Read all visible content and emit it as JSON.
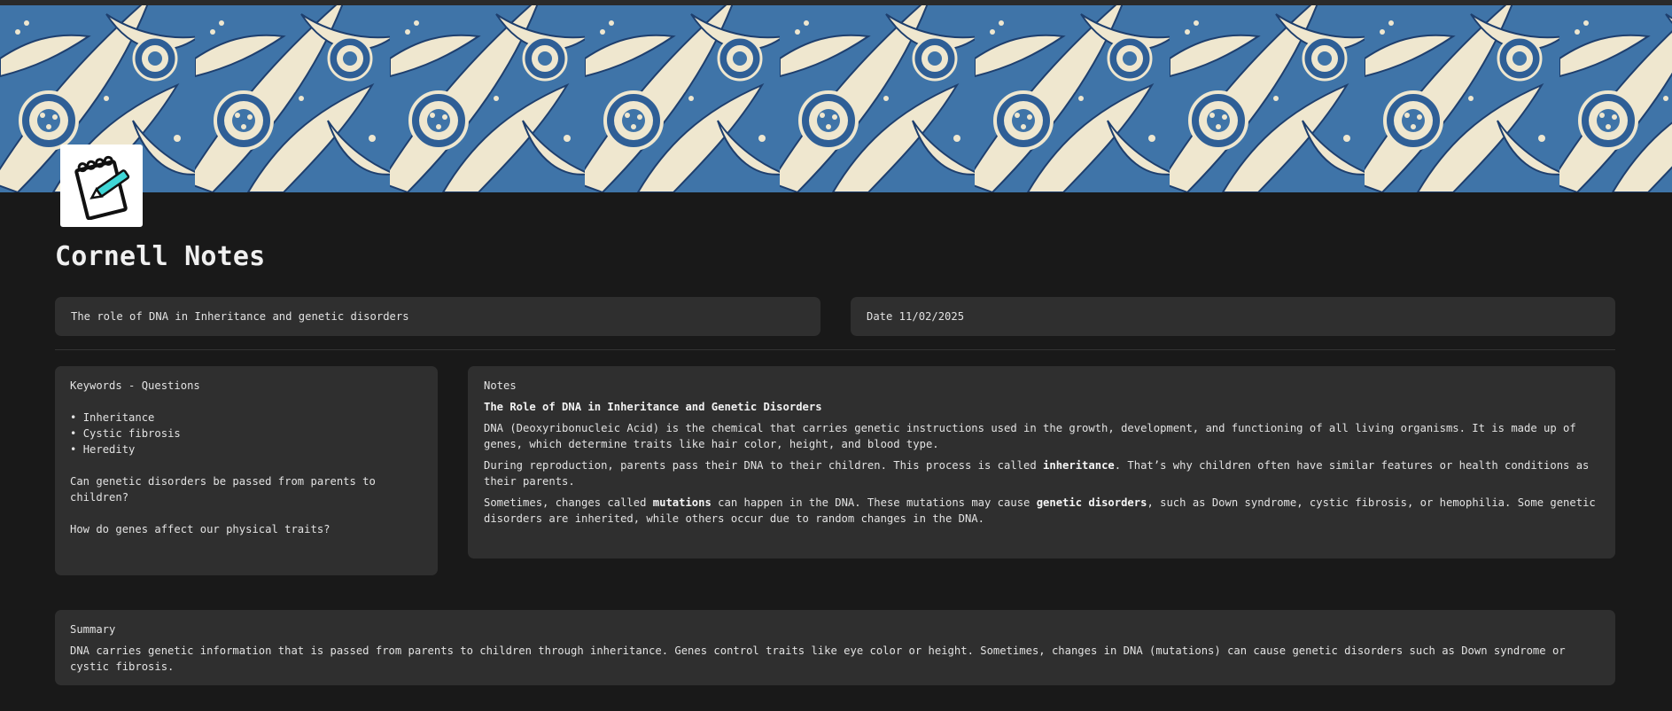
{
  "page": {
    "title": "Cornell Notes",
    "icon": "notepad-pencil-icon"
  },
  "cover": {
    "pattern": "william-morris-marigold",
    "colors": {
      "background": "#3f74a8",
      "leaves": "#efe7cf",
      "outline": "#1e3f6e"
    }
  },
  "topic": {
    "text": "The role of DNA in Inheritance and genetic disorders"
  },
  "date": {
    "text": "Date 11/02/2025"
  },
  "keywords": {
    "heading": "Keywords - Questions",
    "items": [
      "Inheritance",
      "Cystic fibrosis",
      "Heredity"
    ],
    "questions": [
      "Can genetic disorders be passed from parents to children?",
      "How do genes affect our physical traits?"
    ]
  },
  "notes": {
    "heading": "Notes",
    "title": "The Role of DNA in Inheritance and Genetic Disorders",
    "p1": "DNA (Deoxyribonucleic Acid) is the chemical that carries genetic instructions used in the growth, development, and functioning of all living organisms. It is made up of genes, which determine traits like hair color, height, and blood type.",
    "p2_before": "During reproduction, parents pass their DNA to their children. This process is called ",
    "p2_bold": "inheritance",
    "p2_after": ". That’s why children often have similar features or health conditions as their parents.",
    "p3_a": "Sometimes, changes called ",
    "p3_bold1": "mutations",
    "p3_b": " can happen in the DNA. These mutations may cause ",
    "p3_bold2": "genetic disorders",
    "p3_c": ", such as Down syndrome, cystic fibrosis, or hemophilia. Some genetic disorders are inherited, while others occur due to random changes in the DNA."
  },
  "summary": {
    "heading": "Summary",
    "text": "DNA carries genetic information that is passed from parents to children through inheritance. Genes control traits like eye color or height. Sometimes, changes in DNA (mutations) can cause genetic disorders such as Down syndrome or cystic fibrosis."
  },
  "theme": {
    "background": "#191919",
    "card": "#2f2f2f",
    "text": "#e6e6e6",
    "accent_pencil": "#3fd6d6"
  }
}
